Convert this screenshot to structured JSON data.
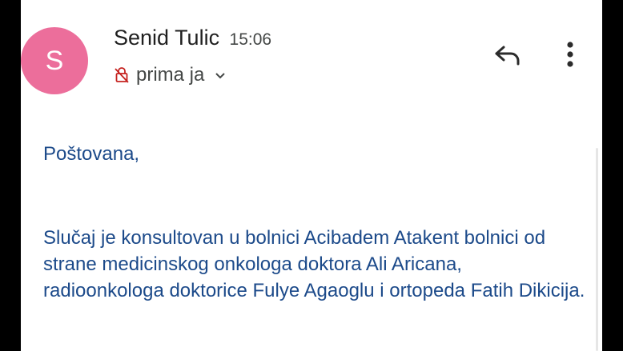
{
  "email": {
    "sender": {
      "initial": "S",
      "name": "Senid Tulic",
      "time": "15:06",
      "avatar_color": "#ec6e9b"
    },
    "recipient": {
      "label": "prima ja",
      "icon": "no-encryption-icon",
      "icon_color": "#c5221f"
    },
    "actions": {
      "reply_icon": "reply-icon",
      "more_icon": "more-vert-icon"
    },
    "body": {
      "greeting": "Poštovana,",
      "paragraph": "Slučaj je konsultovan u bolnici Acibadem Atakent bolnici od strane medicinskog onkologa doktora Ali Aricana, radioonkologa doktorice Fulye Agaoglu i ortopeda Fatih Dikicija.",
      "text_color": "#1c4a8a"
    }
  }
}
